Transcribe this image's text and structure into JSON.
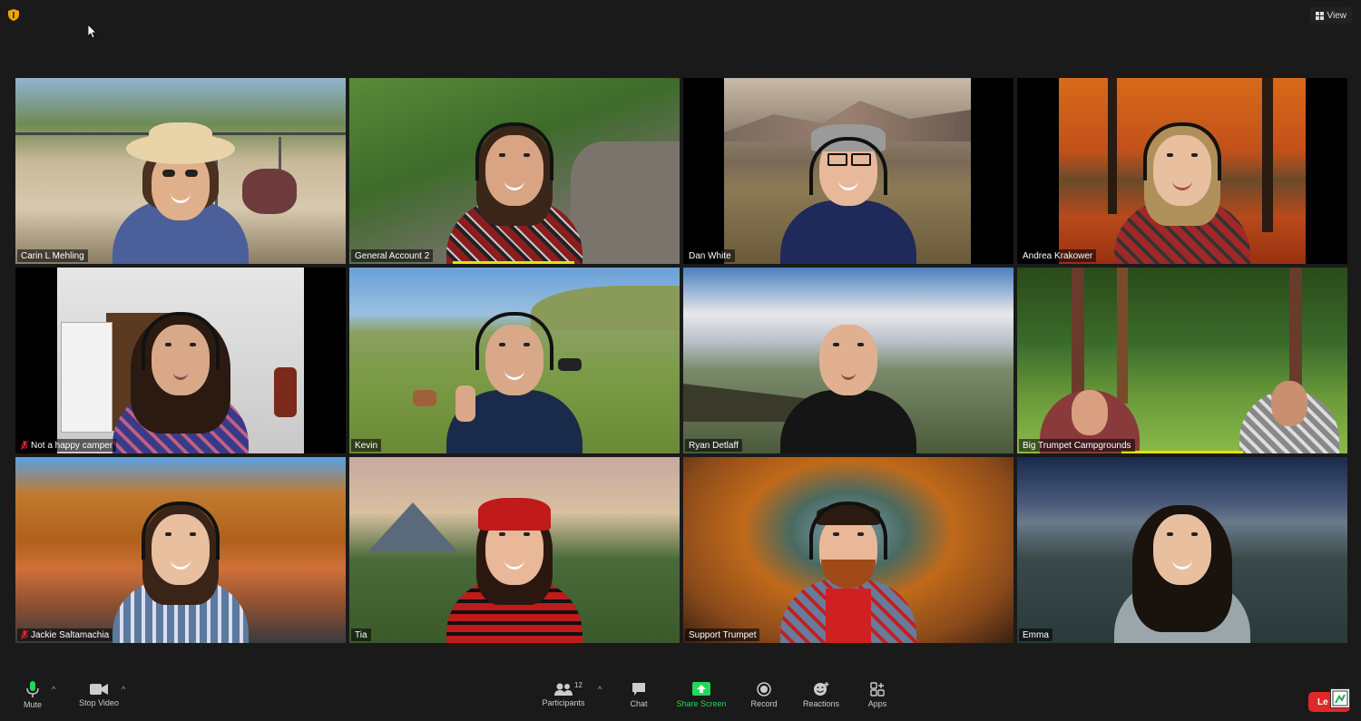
{
  "top_bar": {
    "view_label": "View"
  },
  "tiles": [
    {
      "name": "Carin L Mehling",
      "muted": false,
      "active": true
    },
    {
      "name": "General Account 2",
      "muted": false,
      "active": false
    },
    {
      "name": "Dan White",
      "muted": false,
      "active": false
    },
    {
      "name": "Andrea Krakower",
      "muted": false,
      "active": false
    },
    {
      "name": "Not a happy camper",
      "muted": true,
      "active": false
    },
    {
      "name": "Kevin",
      "muted": false,
      "active": false
    },
    {
      "name": "Ryan Detlaff",
      "muted": false,
      "active": false
    },
    {
      "name": "Big Trumpet Campgrounds",
      "muted": false,
      "active": false
    },
    {
      "name": "Jackie Saltamachia",
      "muted": true,
      "active": false
    },
    {
      "name": "Tia",
      "muted": false,
      "active": false
    },
    {
      "name": "Support Trumpet",
      "muted": false,
      "active": false
    },
    {
      "name": "Emma",
      "muted": false,
      "active": false
    }
  ],
  "toolbar": {
    "mute_label": "Mute",
    "stop_video_label": "Stop Video",
    "participants_label": "Participants",
    "participants_count": "12",
    "chat_label": "Chat",
    "share_screen_label": "Share Screen",
    "record_label": "Record",
    "reactions_label": "Reactions",
    "apps_label": "Apps",
    "leave_label": "Le"
  },
  "colors": {
    "active_speaker_border": "#c6e03a",
    "share_green": "#23d959",
    "leave_red": "#e02828",
    "background": "#1a1a1a"
  }
}
